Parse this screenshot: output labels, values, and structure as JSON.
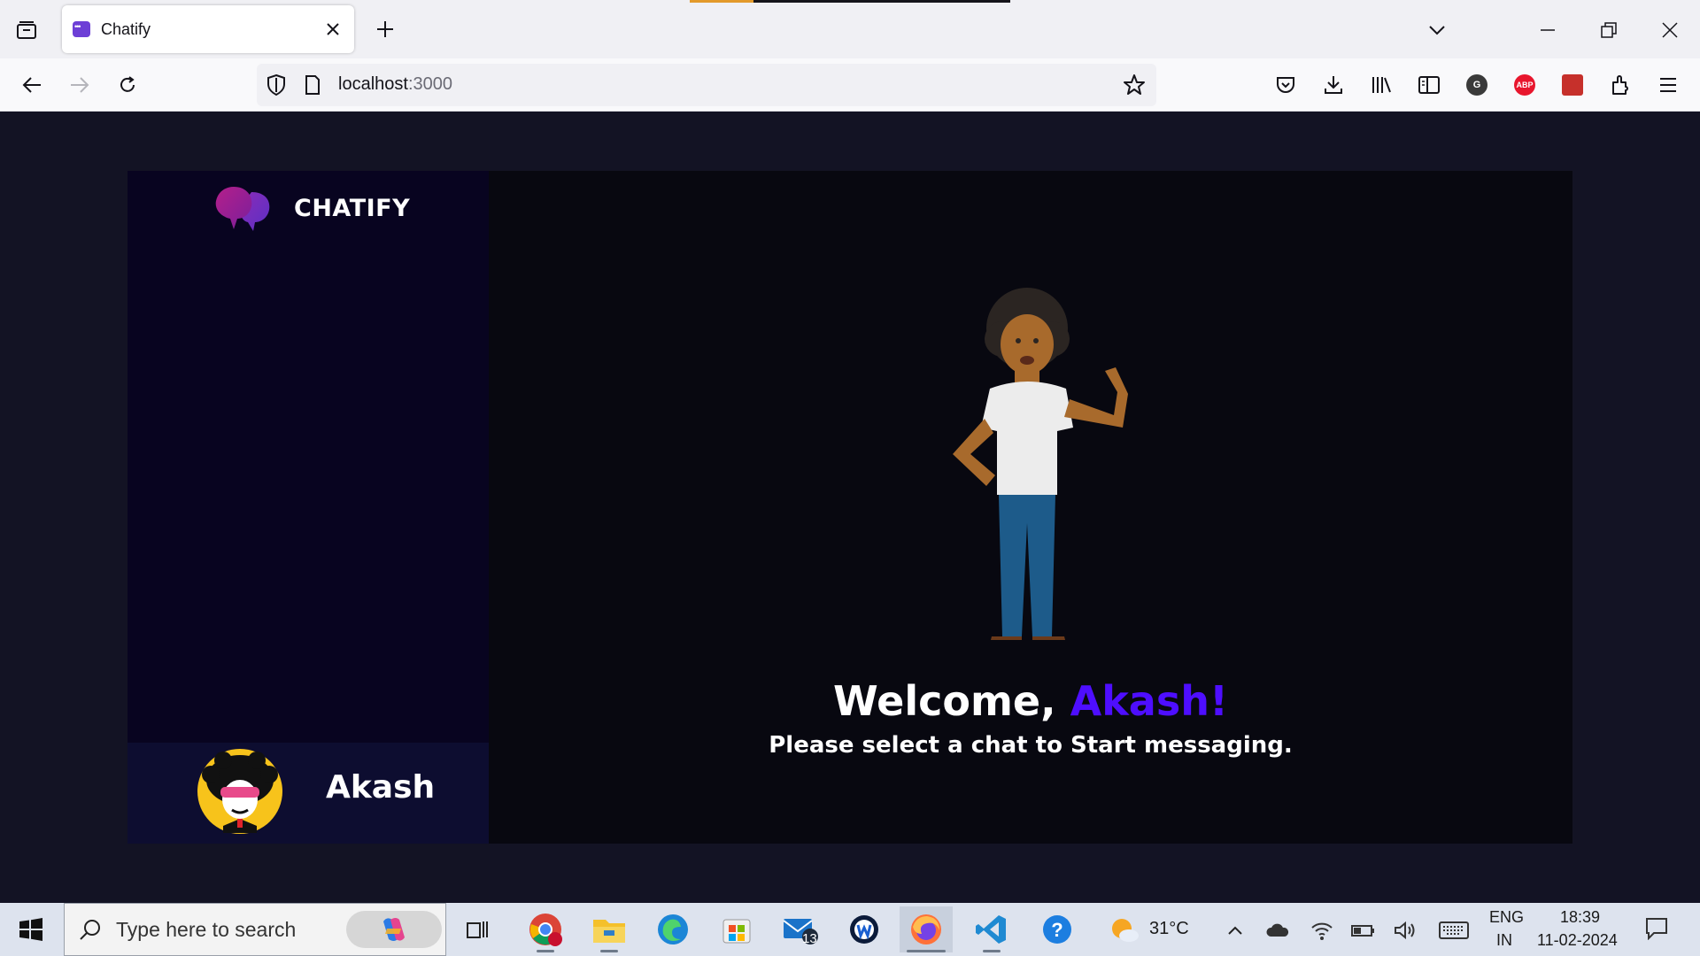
{
  "browser": {
    "tab_title": "Chatify",
    "url_host": "localhost",
    "url_port": ":3000",
    "toolbar_icons": [
      "pocket-icon",
      "downloads-icon",
      "library-icon",
      "sidebar-icon",
      "grammarly-icon",
      "adblock-icon",
      "extension-icon",
      "extensions-icon",
      "menu-icon"
    ],
    "grammarly_label": "G",
    "adblock_label": "ABP"
  },
  "app": {
    "brand": "CHATIFY",
    "current_user": "Akash",
    "welcome_prefix": "Welcome, ",
    "welcome_name": "Akash!",
    "welcome_subtitle": "Please select a chat to Start messaging.",
    "colors": {
      "accent": "#4e0eff",
      "sidebar_bg": "#080420",
      "user_panel_bg": "#0d0d30",
      "page_bg": "#131324"
    }
  },
  "taskbar": {
    "search_placeholder": "Type here to search",
    "mail_badge": "13",
    "weather_temp": "31°C",
    "language_top": "ENG",
    "language_bottom": "IN",
    "time": "18:39",
    "date": "11-02-2024"
  }
}
